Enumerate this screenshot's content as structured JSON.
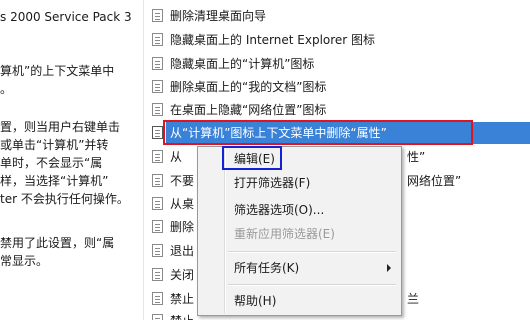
{
  "left_pane": {
    "lines": [
      "s 2000 Service Pack 3",
      "",
      "算机”的上下文菜单中",
      "。",
      "",
      "置，则当用户右键单击",
      "或单击“计算机”并转",
      "单时，不会显示“属",
      "样，当选择“计算机”",
      "ter 不会执行任何操作。",
      "",
      "禁用了此设置，则“属",
      "常显示。"
    ]
  },
  "policy_list": {
    "items": [
      "删除清理桌面向导",
      "隐藏桌面上的 Internet Explorer 图标",
      "隐藏桌面上的“计算机”图标",
      "删除桌面上的“我的文档”图标",
      "在桌面上隐藏“网络位置”图标",
      "从“计算机”图标上下文菜单中删除“属性”",
      "从",
      "不要",
      "从桌",
      "删除",
      "退出",
      "关闭",
      "禁止",
      "禁止"
    ],
    "partial_suffixes": {
      "row7": "性”",
      "row8": "网络位置”",
      "row13": "兰"
    },
    "selected_index": 5
  },
  "context_menu": {
    "items": [
      {
        "label": "编辑(E)",
        "enabled": true
      },
      {
        "label": "打开筛选器(F)",
        "enabled": true
      },
      {
        "label": "筛选器选项(O)...",
        "enabled": true
      },
      {
        "label": "重新应用筛选器(E)",
        "enabled": false
      },
      {
        "label": "所有任务(K)",
        "enabled": true,
        "submenu": true
      },
      {
        "label": "帮助(H)",
        "enabled": true
      }
    ]
  },
  "colors": {
    "selection": "#3a82d8",
    "annotation_red": "#e1141e",
    "annotation_blue": "#1222d6"
  }
}
